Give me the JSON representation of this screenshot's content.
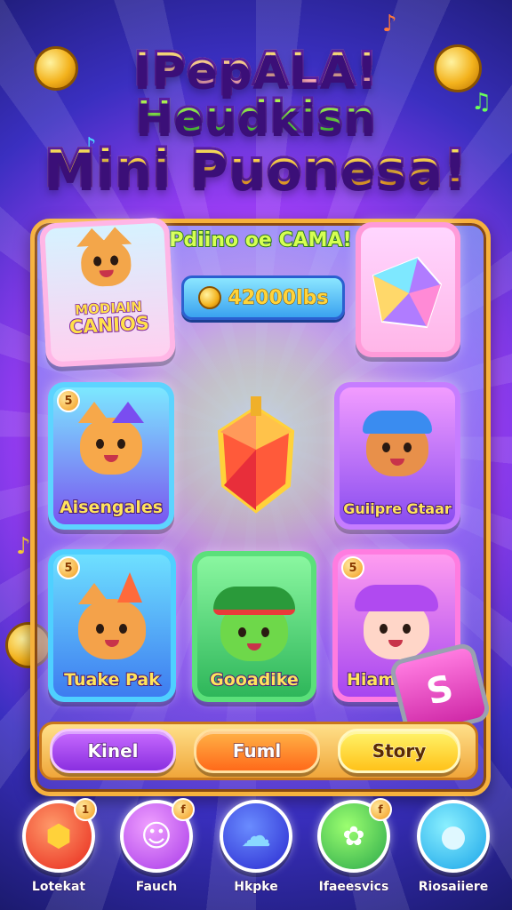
{
  "title": {
    "line1": "IPepALA!",
    "line2": "Heudkisn",
    "line3": "Mini Puonesa!"
  },
  "subtitle": "Pdiino oe CAMA!",
  "coin_counter": "42000lbs",
  "cards": {
    "top_left": {
      "line1": "MODIAIN",
      "line2": "CANIOS"
    },
    "middle_left": {
      "label": "Aisengales",
      "badge": "5"
    },
    "middle_right": {
      "label": "Guiipre Gtaar"
    },
    "bottom_left": {
      "label": "Tuake Pak",
      "badge": "5"
    },
    "bottom_middle": {
      "label": "Gooadike"
    },
    "bottom_right": {
      "label": "Hiam I",
      "badge": "5"
    }
  },
  "buttons": {
    "b1": "Kinel",
    "b2": "Fuml",
    "b3": "Story"
  },
  "nav": [
    {
      "label": "Lotekat",
      "badge": "1",
      "icon": "shield-icon"
    },
    {
      "label": "Fauch",
      "badge": "f",
      "icon": "ghost-icon"
    },
    {
      "label": "Hkpke",
      "badge": "",
      "icon": "cloud-icon"
    },
    {
      "label": "Ifaeesvics",
      "badge": "f",
      "icon": "cat-icon"
    },
    {
      "label": "Riosaiiere",
      "badge": "",
      "icon": "bubble-icon"
    }
  ],
  "colors": {
    "frame": "#f6b13c",
    "accent_yellow": "#ffe45c",
    "accent_purple": "#8a2fe0"
  }
}
